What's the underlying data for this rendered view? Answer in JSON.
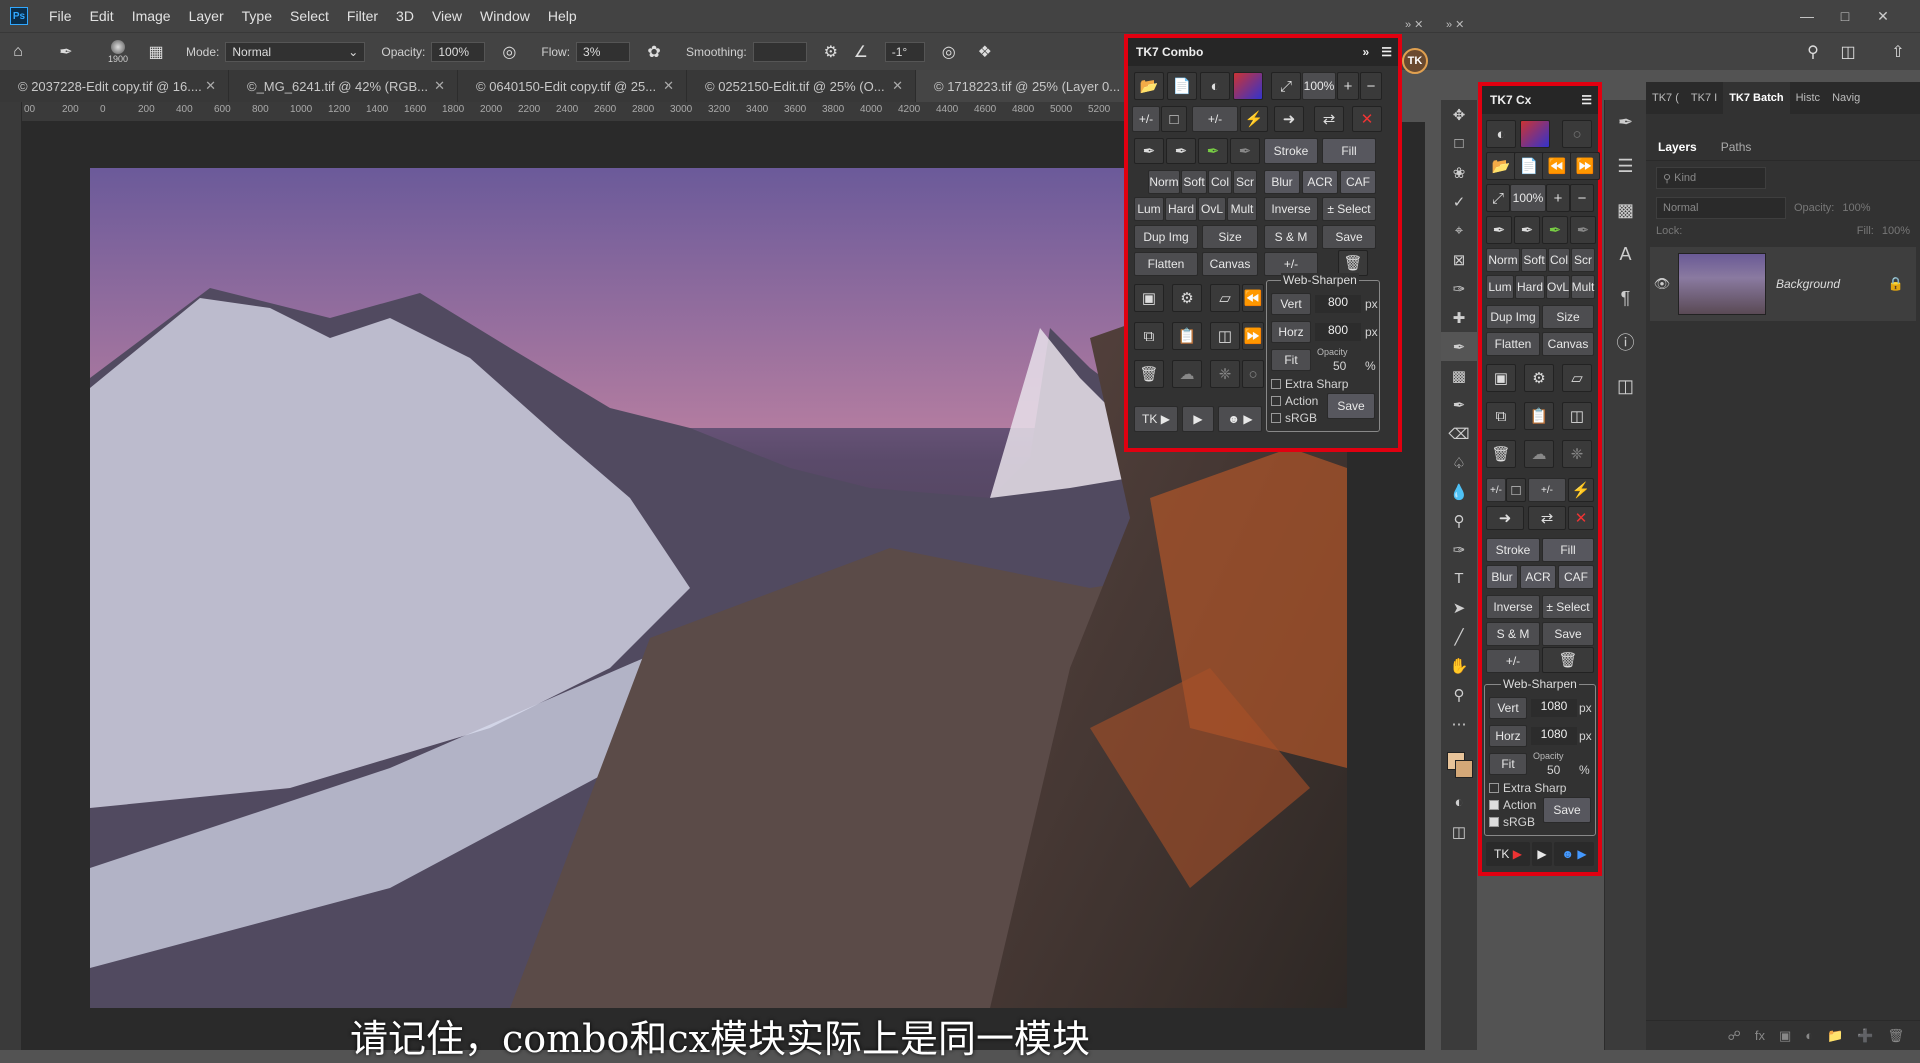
{
  "menubar": {
    "logo": "Ps",
    "items": [
      "File",
      "Edit",
      "Image",
      "Layer",
      "Type",
      "Select",
      "Filter",
      "3D",
      "View",
      "Window",
      "Help"
    ]
  },
  "options": {
    "brush_size": "1900",
    "mode_label": "Mode:",
    "mode_value": "Normal",
    "opacity_label": "Opacity:",
    "opacity_value": "100%",
    "flow_label": "Flow:",
    "flow_value": "3%",
    "smoothing_label": "Smoothing:",
    "angle_value": "-1°"
  },
  "doc_tabs": [
    "© 2037228-Edit copy.tif @ 16....",
    "©_MG_6241.tif @ 42% (RGB...",
    "© 0640150-Edit copy.tif @ 25...",
    "© 0252150-Edit.tif @ 25% (O...",
    "© 1718223.tif @ 25% (Layer 0..."
  ],
  "ruler_ticks": [
    "00",
    "200",
    "0",
    "200",
    "400",
    "600",
    "800",
    "1000",
    "1200",
    "1400",
    "1600",
    "1800",
    "2000",
    "2200",
    "2400",
    "2600",
    "2800",
    "3000",
    "3200",
    "3400",
    "3600",
    "3800",
    "4000",
    "4200",
    "4400",
    "4600",
    "4800",
    "5000",
    "5200",
    "54"
  ],
  "subtitle": "请记住，combo和cx模块实际上是同一模块",
  "combo": {
    "title": "TK7 Combo",
    "zoom": "100%",
    "btn_stroke": "Stroke",
    "btn_fill": "Fill",
    "btn_blur": "Blur",
    "btn_acr": "ACR",
    "btn_caf": "CAF",
    "btn_norm": "Norm",
    "btn_soft": "Soft",
    "btn_col": "Col",
    "btn_scr": "Scr",
    "btn_lum": "Lum",
    "btn_hard": "Hard",
    "btn_ovl": "OvL",
    "btn_mult": "Mult",
    "btn_inverse": "Inverse",
    "btn_select": "± Select",
    "btn_dupimg": "Dup Img",
    "btn_size": "Size",
    "btn_sm": "S & M",
    "btn_save": "Save",
    "btn_flatten": "Flatten",
    "btn_canvas": "Canvas",
    "pm1": "+/-",
    "pm2": "+/-",
    "pm3": "+/-",
    "ws_title": "Web-Sharpen",
    "vert": "Vert",
    "vert_val": "800",
    "horz": "Horz",
    "horz_val": "800",
    "px": "px",
    "fit": "Fit",
    "opacity_label": "Opacity",
    "opacity_val": "50",
    "pct": "%",
    "extra_sharp": "Extra Sharp",
    "action": "Action",
    "srgb": "sRGB",
    "ws_save": "Save",
    "tk": "TK"
  },
  "cx": {
    "title": "TK7 Cx",
    "zoom": "100%",
    "btn_norm": "Norm",
    "btn_soft": "Soft",
    "btn_col": "Col",
    "btn_scr": "Scr",
    "btn_lum": "Lum",
    "btn_hard": "Hard",
    "btn_ovl": "OvL",
    "btn_mult": "Mult",
    "btn_dupimg": "Dup Img",
    "btn_size": "Size",
    "btn_flatten": "Flatten",
    "btn_canvas": "Canvas",
    "btn_stroke": "Stroke",
    "btn_fill": "Fill",
    "btn_blur": "Blur",
    "btn_acr": "ACR",
    "btn_caf": "CAF",
    "btn_inverse": "Inverse",
    "btn_select": "± Select",
    "btn_sm": "S & M",
    "btn_save": "Save",
    "pm1": "+/-",
    "pm2": "+/-",
    "pm3": "+/-",
    "ws_title": "Web-Sharpen",
    "vert": "Vert",
    "vert_val": "1080",
    "horz": "Horz",
    "horz_val": "1080",
    "px": "px",
    "fit": "Fit",
    "opacity_label": "Opacity",
    "opacity_val": "50",
    "pct": "%",
    "extra_sharp": "Extra Sharp",
    "action": "Action",
    "srgb": "sRGB",
    "ws_save": "Save",
    "tk": "TK"
  },
  "right_panel": {
    "tabs": [
      "TK7 (",
      "TK7 I",
      "TK7 Batch",
      "Histc",
      "Navig"
    ],
    "sub_tabs": [
      "Layers",
      "Paths"
    ],
    "kind": "Kind",
    "blend": "Normal",
    "opacity": "Opacity:",
    "opacity_val": "100%",
    "lock": "Lock:",
    "fill": "Fill:",
    "fill_val": "100%",
    "layer_name": "Background"
  },
  "colors": {
    "accent_red": "#e10010",
    "panel_bg": "#323232",
    "fg_swatch": "#e8c49a"
  }
}
